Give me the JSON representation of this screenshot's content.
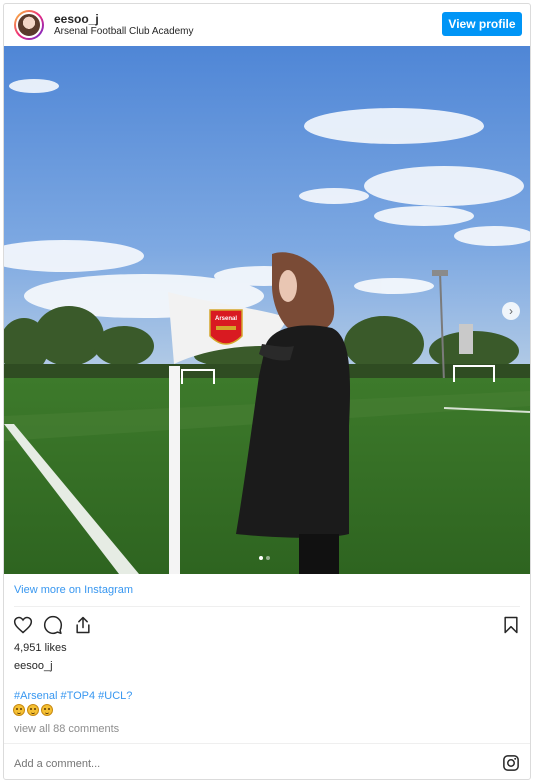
{
  "header": {
    "username": "eesoo_j",
    "location": "Arsenal Football Club Academy",
    "view_profile_label": "View profile"
  },
  "photo": {
    "flag_crest_text": "Arsenal",
    "carousel_total": 2,
    "carousel_index": 1
  },
  "links": {
    "view_more": "View more on Instagram"
  },
  "post": {
    "likes": "4,951 likes",
    "owner": "eesoo_j",
    "caption_hashtags": "#Arsenal #TOP4 #UCL?",
    "caption_emoji_count": 3,
    "view_comments": "view all 88 comments"
  },
  "comment": {
    "placeholder": "Add a comment..."
  },
  "colors": {
    "accent": "#0095f6",
    "link": "#3897f0",
    "muted": "#8e8e8e",
    "sky": "#5d8fd4",
    "grass": "#3f7a2c"
  },
  "icons": [
    "heart-icon",
    "comment-icon",
    "share-icon",
    "bookmark-icon",
    "instagram-icon",
    "chevron-right-icon"
  ]
}
